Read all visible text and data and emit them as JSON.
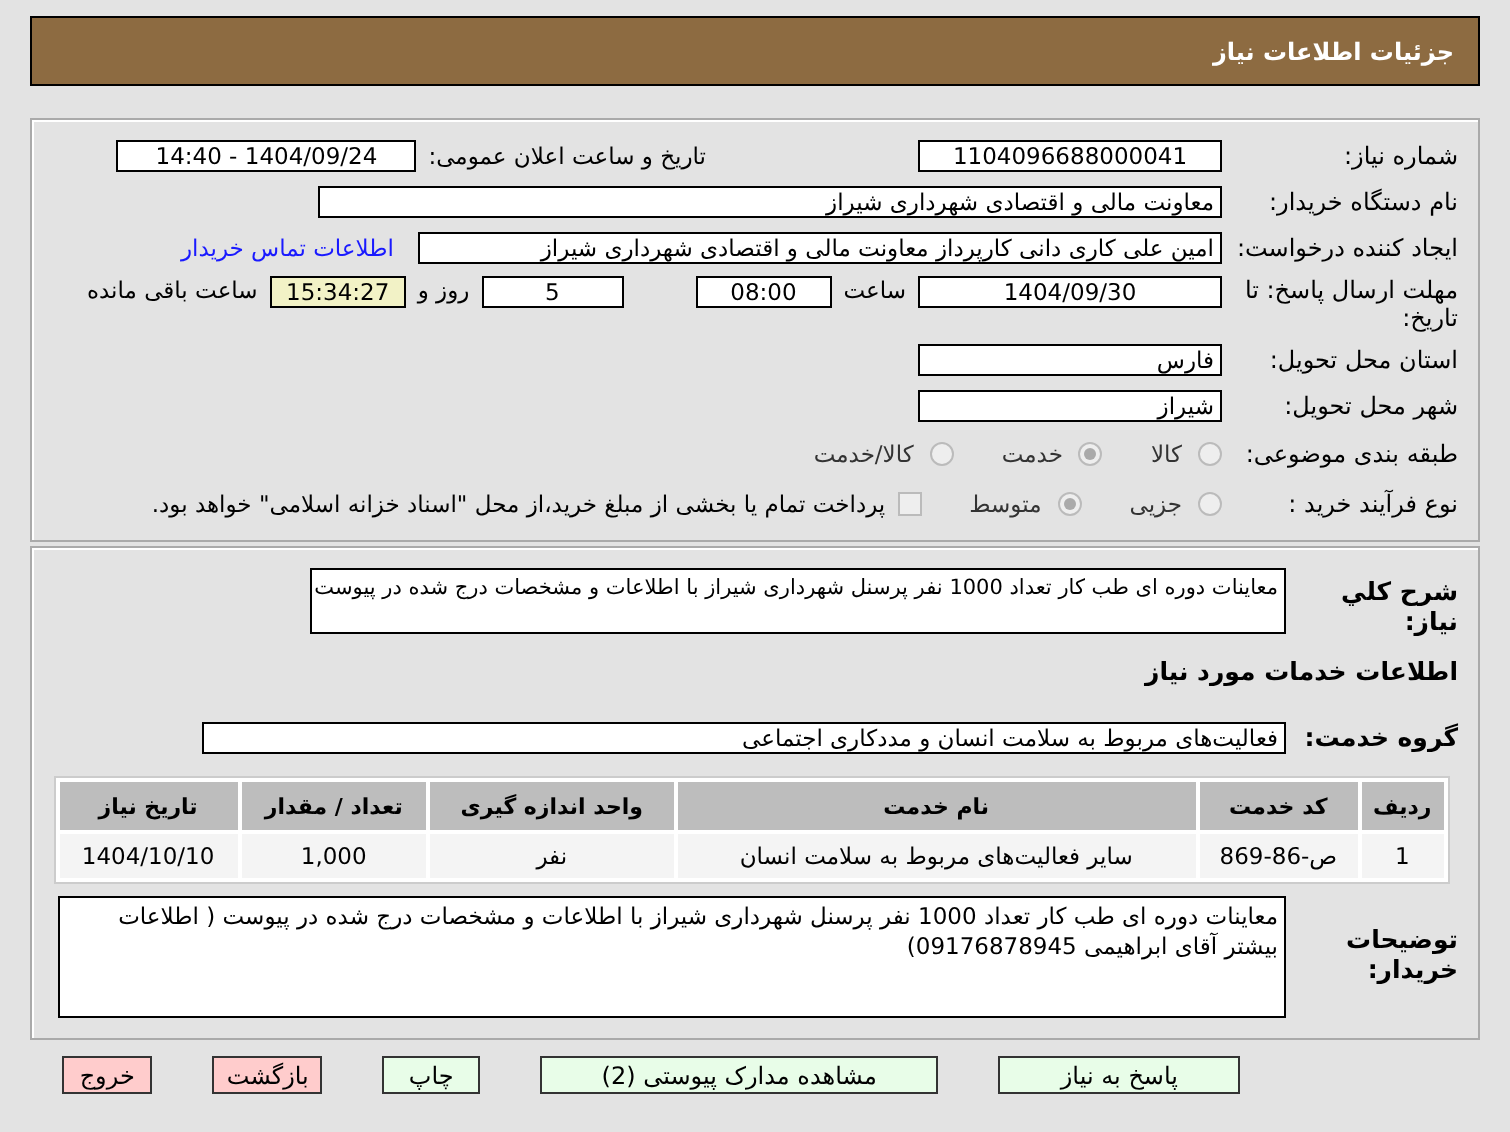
{
  "header": {
    "title": "جزئیات اطلاعات نیاز"
  },
  "need_number": {
    "label": "شماره نیاز:",
    "value": "1104096688000041"
  },
  "announce": {
    "label": "تاریخ و ساعت اعلان عمومی:",
    "value": "1404/09/24 - 14:40"
  },
  "buyer": {
    "label": "نام دستگاه خریدار:",
    "value": "معاونت مالی و اقتصادی شهرداری شیراز"
  },
  "requester": {
    "label": "ایجاد کننده درخواست:",
    "value": "امین علی کاری دانی کارپرداز معاونت مالی و اقتصادی شهرداری شیراز",
    "link": "اطلاعات تماس خریدار"
  },
  "deadline": {
    "label": "مهلت ارسال پاسخ: تا تاریخ:",
    "date": "1404/09/30",
    "time_label": "ساعت",
    "time": "08:00",
    "days": "5",
    "days_label": "روز و",
    "remaining": "15:34:27",
    "remaining_label": "ساعت باقی مانده"
  },
  "province": {
    "label": "استان محل تحویل:",
    "value": "فارس"
  },
  "city": {
    "label": "شهر محل تحویل:",
    "value": "شیراز"
  },
  "category": {
    "label": "طبقه بندی موضوعی:",
    "options": [
      {
        "label": "کالا",
        "selected": false
      },
      {
        "label": "خدمت",
        "selected": true
      },
      {
        "label": "کالا/خدمت",
        "selected": false
      }
    ]
  },
  "process": {
    "label": "نوع فرآیند خرید :",
    "options": [
      {
        "label": "جزیی",
        "selected": false
      },
      {
        "label": "متوسط",
        "selected": true
      }
    ],
    "payment": {
      "checked": false,
      "text": "پرداخت تمام یا بخشی از مبلغ خرید،از محل \"اسناد خزانه اسلامی\" خواهد بود."
    }
  },
  "description": {
    "label": "شرح کلي نیاز:",
    "value": "معاینات دوره ای طب کار تعداد 1000 نفر پرسنل شهرداری شیراز با اطلاعات و مشخصات درج شده در پیوست"
  },
  "services_title": "اطلاعات خدمات مورد نیاز",
  "service_group": {
    "label": "گروه خدمت:",
    "value": "فعالیت‌های مربوط به سلامت انسان و مددکاری اجتماعی"
  },
  "table": {
    "columns": [
      "ردیف",
      "کد خدمت",
      "نام خدمت",
      "واحد اندازه گیری",
      "تعداد / مقدار",
      "تاریخ نیاز"
    ],
    "rows": [
      [
        "1",
        "ص-86-869",
        "سایر فعالیت‌های مربوط به سلامت انسان",
        "نفر",
        "1,000",
        "1404/10/10"
      ]
    ]
  },
  "buyer_notes": {
    "label": "توضیحات خریدار:",
    "value": "معاینات دوره ای طب کار تعداد 1000 نفر پرسنل شهرداری شیراز  با اطلاعات و مشخصات درج شده در پیوست  ( اطلاعات بیشتر آقای ابراهیمی  09176878945)"
  },
  "buttons": [
    {
      "label": "پاسخ به نیاز",
      "kind": "ok"
    },
    {
      "label": "مشاهده مدارک پیوستی (2)",
      "kind": "ok"
    },
    {
      "label": "چاپ",
      "kind": "ok"
    },
    {
      "label": "بازگشت",
      "kind": "cancel"
    },
    {
      "label": "خروج",
      "kind": "cancel"
    }
  ]
}
